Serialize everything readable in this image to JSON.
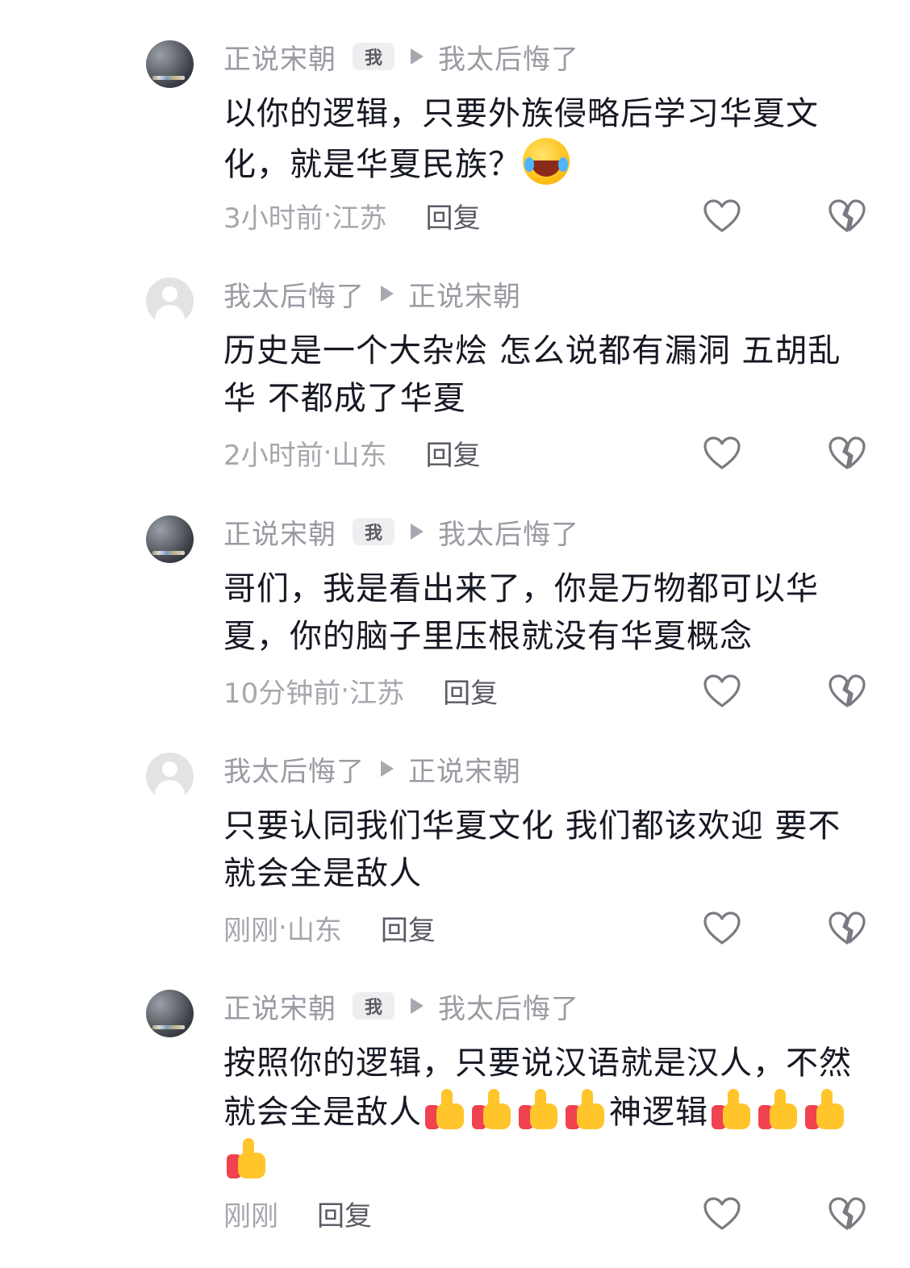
{
  "comments": [
    {
      "author": "正说宋朝",
      "badge": "我",
      "reply_to": "我太后悔了",
      "text_parts": [
        "以你的逻辑，只要外族侵略后学习华夏文化，就是华夏民族？"
      ],
      "time": "3小时前",
      "location": "江苏",
      "separator": "·",
      "reply_label": "回复"
    },
    {
      "author": "我太后悔了",
      "reply_to": "正说宋朝",
      "text_parts": [
        "历史是一个大杂烩 怎么说都有漏洞 五胡乱华 不都成了华夏"
      ],
      "time": "2小时前",
      "location": "山东",
      "separator": "·",
      "reply_label": "回复"
    },
    {
      "author": "正说宋朝",
      "badge": "我",
      "reply_to": "我太后悔了",
      "text_parts": [
        "哥们，我是看出来了，你是万物都可以华夏，你的脑子里压根就没有华夏概念"
      ],
      "time": "10分钟前",
      "location": "江苏",
      "separator": "·",
      "reply_label": "回复"
    },
    {
      "author": "我太后悔了",
      "reply_to": "正说宋朝",
      "text_parts": [
        "只要认同我们华夏文化 我们都该欢迎 要不就会全是敌人"
      ],
      "time": "刚刚",
      "location": "山东",
      "separator": "·",
      "reply_label": "回复"
    },
    {
      "author": "正说宋朝",
      "badge": "我",
      "reply_to": "我太后悔了",
      "text_parts": [
        "按照你的逻辑，只要说汉语就是汉人，不然就会全是敌人",
        "神逻辑"
      ],
      "time": "刚刚",
      "reply_label": "回复"
    }
  ],
  "icons": {
    "laugh_cry_emoji": "face-with-tears-of-joy",
    "thumbs_up_emoji": "thumbs-up",
    "like": "heart-outline",
    "dislike": "broken-heart-outline"
  },
  "colors": {
    "text": "#161823",
    "meta": "#a6a7ad",
    "username": "#9a9ba3",
    "reply": "#5a5b63"
  }
}
